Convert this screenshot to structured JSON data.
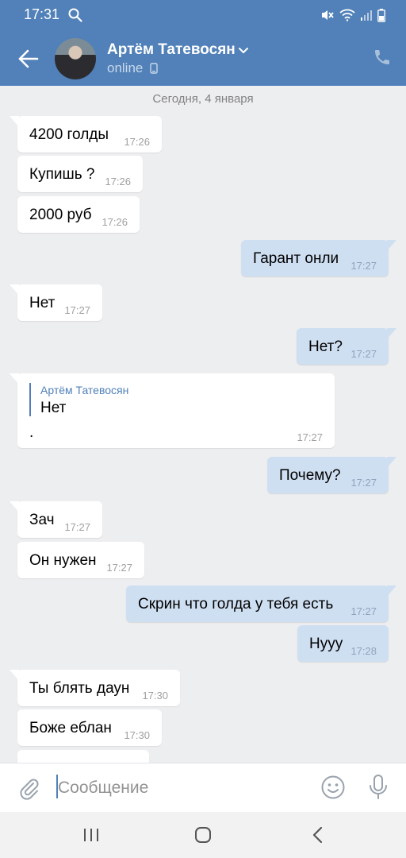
{
  "status_bar": {
    "time": "17:31"
  },
  "header": {
    "contact_name": "Артём Татевосян",
    "contact_status": "online"
  },
  "chat": {
    "date_separator": "Сегодня, 4 января",
    "messages": [
      {
        "direction": "in",
        "text": "4200 голды",
        "time": "17:26"
      },
      {
        "direction": "in",
        "text": "Купишь ?",
        "time": "17:26"
      },
      {
        "direction": "in",
        "text": "2000 руб",
        "time": "17:26"
      },
      {
        "direction": "out",
        "text": "Гарант онли",
        "time": "17:27"
      },
      {
        "direction": "in",
        "text": "Нет",
        "time": "17:27"
      },
      {
        "direction": "out",
        "text": "Нет?",
        "time": "17:27"
      },
      {
        "direction": "in",
        "quote_author": "Артём Татевосян",
        "quote_text": "Нет",
        "text": ".",
        "time": "17:27"
      },
      {
        "direction": "out",
        "text": "Почему?",
        "time": "17:27"
      },
      {
        "direction": "in",
        "text": "Зач",
        "time": "17:27"
      },
      {
        "direction": "in",
        "text": "Он нужен",
        "time": "17:27"
      },
      {
        "direction": "out",
        "text": "Скрин что голда у тебя есть",
        "time": "17:27"
      },
      {
        "direction": "out",
        "text": "Нууу",
        "time": "17:28"
      },
      {
        "direction": "in",
        "text": "Ты блять даун",
        "time": "17:30"
      },
      {
        "direction": "in",
        "text": "Боже еблан",
        "time": "17:30"
      }
    ]
  },
  "input": {
    "placeholder": "Сообщение",
    "value": ""
  },
  "colors": {
    "header": "#5181b8",
    "background": "#edeef0",
    "outgoing_bubble": "#cfdff2",
    "incoming_bubble": "#ffffff"
  }
}
